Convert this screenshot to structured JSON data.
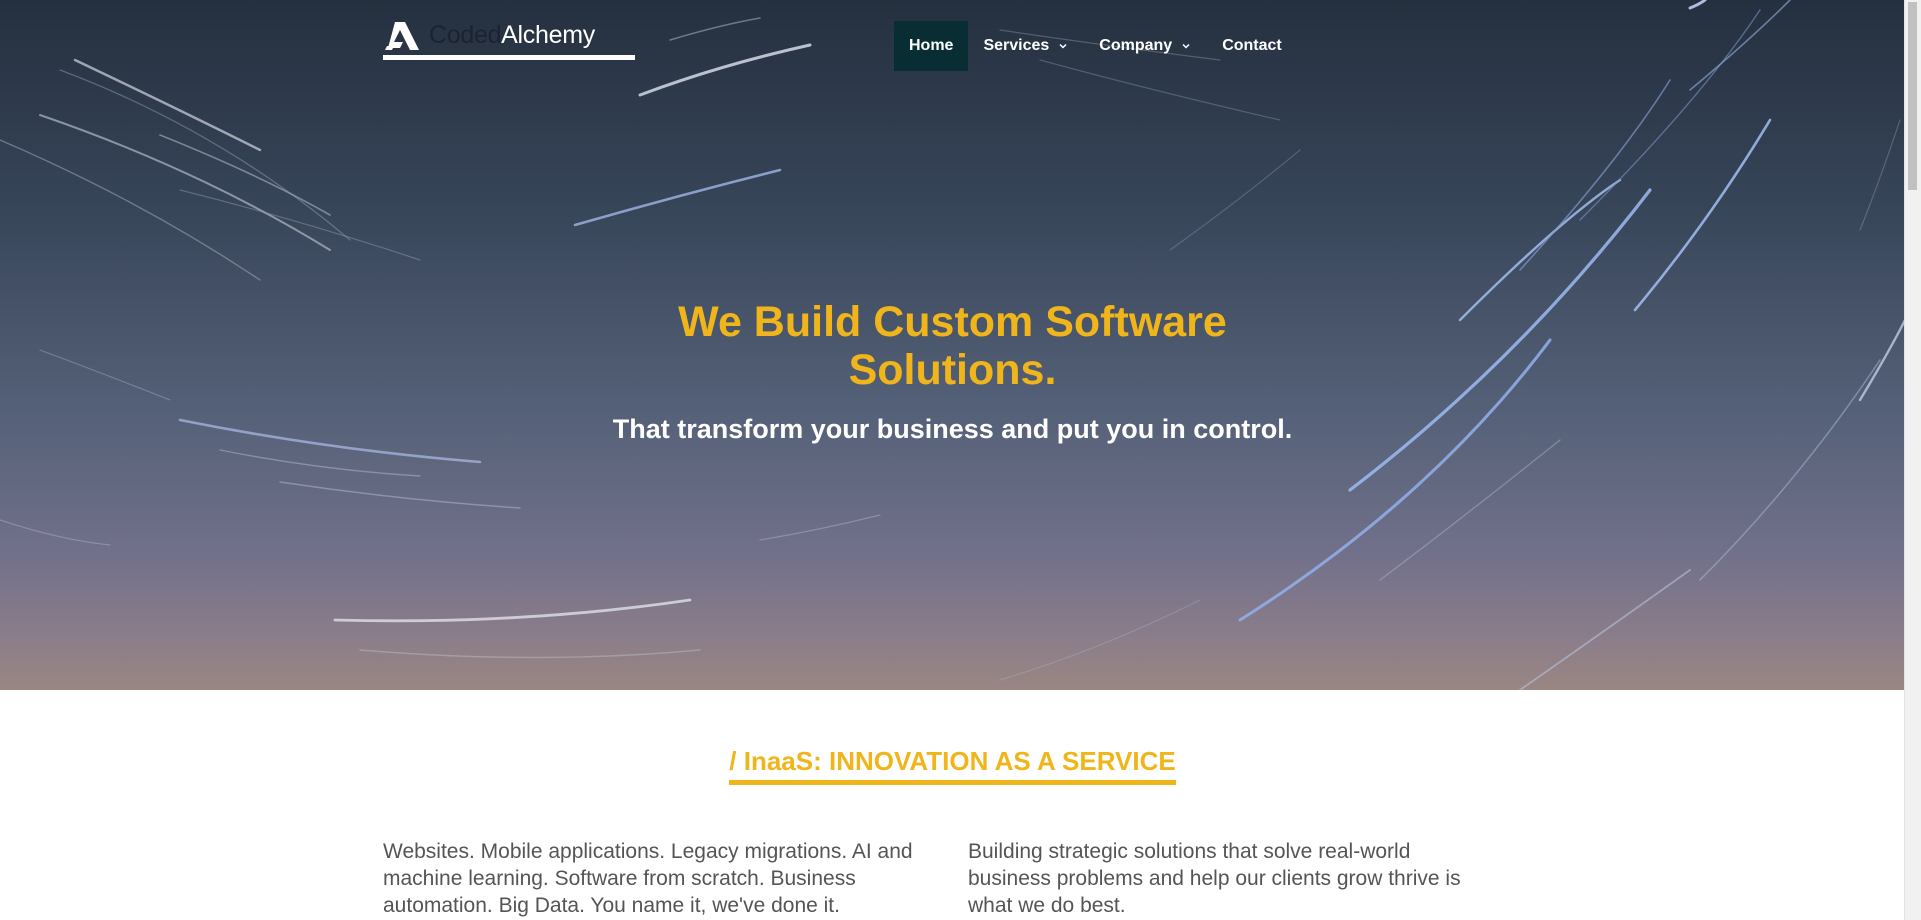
{
  "header": {
    "logo_coded": "Coded",
    "logo_alchemy": "Alchemy",
    "logo_icon": "a-letter-logo-icon"
  },
  "nav": {
    "items": [
      {
        "label": "Home",
        "active": true,
        "has_dropdown": false
      },
      {
        "label": "Services",
        "active": false,
        "has_dropdown": true
      },
      {
        "label": "Company",
        "active": false,
        "has_dropdown": true
      },
      {
        "label": "Contact",
        "active": false,
        "has_dropdown": false
      }
    ],
    "dropdown_icon": "chevron-down-icon"
  },
  "hero": {
    "title_line1": "We Build Custom Software",
    "title_line2": "Solutions.",
    "subtitle": "That transform your business and put you in control."
  },
  "section": {
    "heading": "/ InaaS: INNOVATION AS A SERVICE",
    "left_text": "Websites. Mobile applications. Legacy migrations. AI and machine learning. Software from scratch. Business automation. Big Data. You name it, we've done it.",
    "right_text": "Building strategic solutions that solve real-world business problems and help our clients grow thrive is what we do best."
  },
  "colors": {
    "accent": "#f0b51a",
    "nav_active_bg": "#082e33",
    "body_text": "#555555"
  }
}
